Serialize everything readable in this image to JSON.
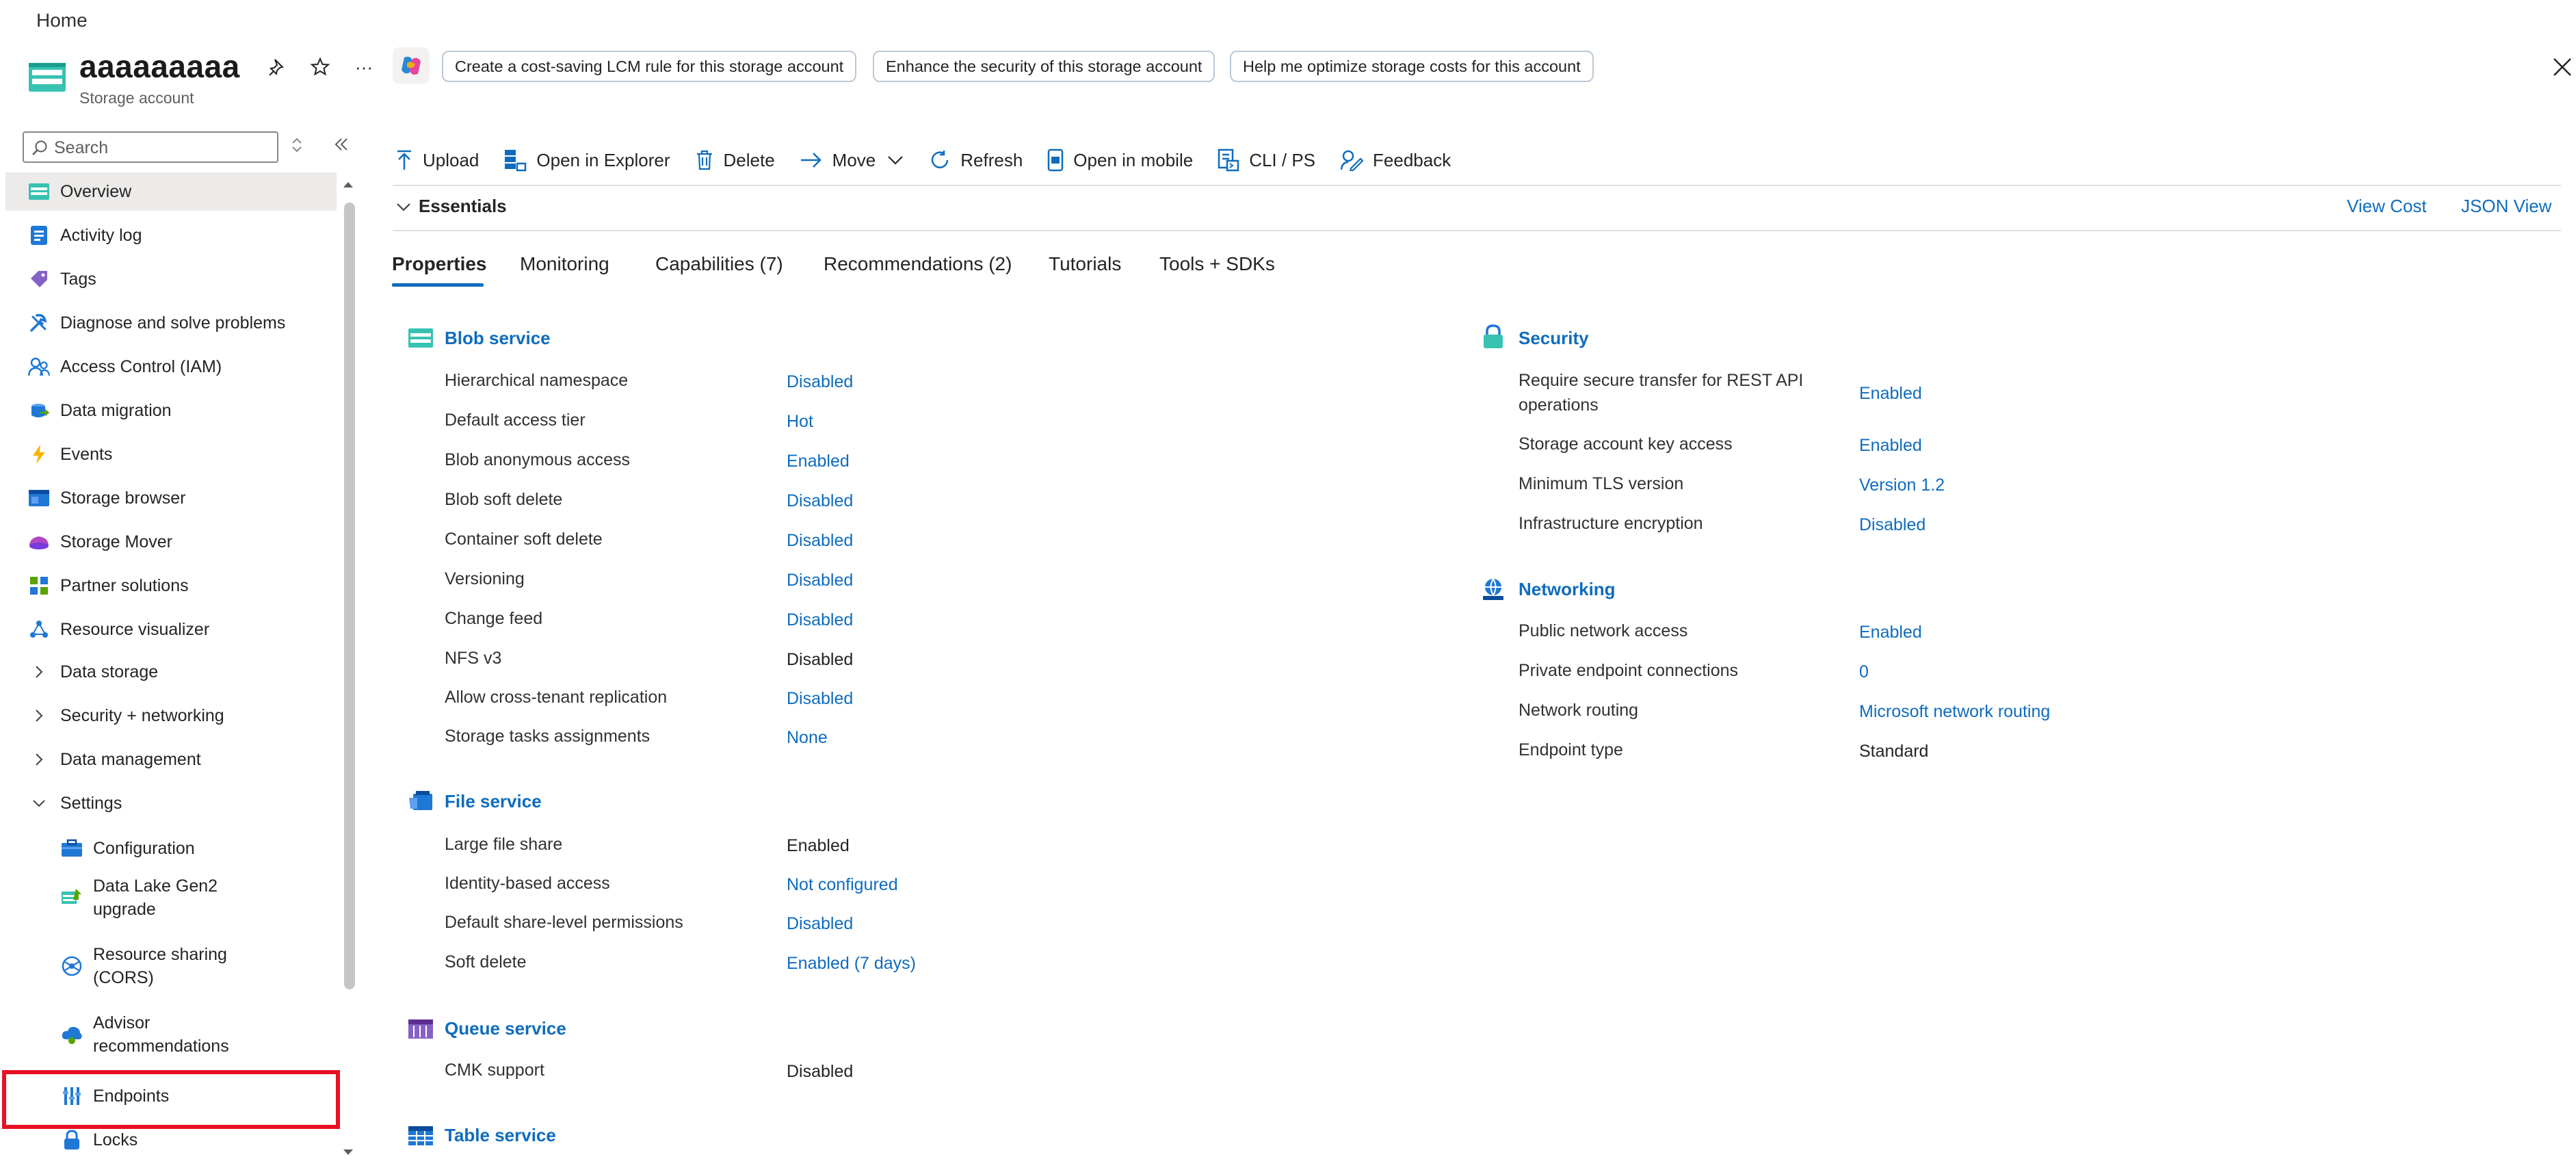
{
  "breadcrumb": "Home",
  "header": {
    "title": "aaaaaaaaa",
    "subtitle": "Storage account",
    "chips": [
      "Create a cost-saving LCM rule for this storage account",
      "Enhance the security of this storage account",
      "Help me optimize storage costs for this account"
    ],
    "more": "···"
  },
  "sidebar": {
    "search_placeholder": "Search",
    "items": [
      {
        "label": "Overview",
        "icon": "overview-icon"
      },
      {
        "label": "Activity log",
        "icon": "activity-log-icon"
      },
      {
        "label": "Tags",
        "icon": "tag-icon"
      },
      {
        "label": "Diagnose and solve problems",
        "icon": "wrench-icon"
      },
      {
        "label": "Access Control (IAM)",
        "icon": "people-icon"
      },
      {
        "label": "Data migration",
        "icon": "data-migration-icon"
      },
      {
        "label": "Events",
        "icon": "lightning-icon"
      },
      {
        "label": "Storage browser",
        "icon": "storage-browser-icon"
      },
      {
        "label": "Storage Mover",
        "icon": "storage-mover-icon"
      },
      {
        "label": "Partner solutions",
        "icon": "partner-icon"
      },
      {
        "label": "Resource visualizer",
        "icon": "visualizer-icon"
      }
    ],
    "groups": [
      "Data storage",
      "Security + networking",
      "Data management",
      "Settings"
    ],
    "settings_children": [
      {
        "label": "Configuration",
        "icon": "configuration-icon"
      },
      {
        "label": "Data Lake Gen2",
        "label2": "upgrade",
        "icon": "data-lake-icon"
      },
      {
        "label": "Resource sharing",
        "label2": "(CORS)",
        "icon": "cors-icon"
      },
      {
        "label": "Advisor",
        "label2": "recommendations",
        "icon": "advisor-icon"
      },
      {
        "label": "Endpoints",
        "icon": "endpoints-icon"
      },
      {
        "label": "Locks",
        "icon": "lock-icon"
      }
    ]
  },
  "toolbar": {
    "upload": "Upload",
    "open_explorer": "Open in Explorer",
    "delete": "Delete",
    "move": "Move",
    "refresh": "Refresh",
    "open_mobile": "Open in mobile",
    "cli": "CLI / PS",
    "feedback": "Feedback"
  },
  "essentials": {
    "label": "Essentials",
    "view_cost": "View Cost",
    "json_view": "JSON View"
  },
  "tabs": [
    "Properties",
    "Monitoring",
    "Capabilities (7)",
    "Recommendations (2)",
    "Tutorials",
    "Tools + SDKs"
  ],
  "blob": {
    "title": "Blob service",
    "rows": [
      {
        "label": "Hierarchical namespace",
        "value": "Disabled"
      },
      {
        "label": "Default access tier",
        "value": "Hot"
      },
      {
        "label": "Blob anonymous access",
        "value": "Enabled"
      },
      {
        "label": "Blob soft delete",
        "value": "Disabled"
      },
      {
        "label": "Container soft delete",
        "value": "Disabled"
      },
      {
        "label": "Versioning",
        "value": "Disabled"
      },
      {
        "label": "Change feed",
        "value": "Disabled"
      },
      {
        "label": "NFS v3",
        "value": "Disabled"
      },
      {
        "label": "Allow cross-tenant replication",
        "value": "Disabled"
      },
      {
        "label": "Storage tasks assignments",
        "value": "None"
      }
    ]
  },
  "file": {
    "title": "File service",
    "rows": [
      {
        "label": "Large file share",
        "value": "Enabled"
      },
      {
        "label": "Identity-based access",
        "value": "Not configured"
      },
      {
        "label": "Default share-level permissions",
        "value": "Disabled"
      },
      {
        "label": "Soft delete",
        "value": "Enabled (7 days)"
      }
    ]
  },
  "queue": {
    "title": "Queue service",
    "rows": [
      {
        "label": "CMK support",
        "value": "Disabled"
      }
    ]
  },
  "table": {
    "title": "Table service"
  },
  "security": {
    "title": "Security",
    "rows": [
      {
        "label": "Require secure transfer for REST API",
        "label2": "operations",
        "value": "Enabled"
      },
      {
        "label": "Storage account key access",
        "value": "Enabled"
      },
      {
        "label": "Minimum TLS version",
        "value": "Version 1.2"
      },
      {
        "label": "Infrastructure encryption",
        "value": "Disabled"
      }
    ]
  },
  "networking": {
    "title": "Networking",
    "rows": [
      {
        "label": "Public network access",
        "value": "Enabled"
      },
      {
        "label": "Private endpoint connections",
        "value": "0"
      },
      {
        "label": "Network routing",
        "value": "Microsoft network routing"
      },
      {
        "label": "Endpoint type",
        "value": "Standard"
      }
    ]
  },
  "colors": {
    "accent": "#0f6cbd",
    "highlight": "#e81123",
    "selected_bg": "#edebe9"
  }
}
